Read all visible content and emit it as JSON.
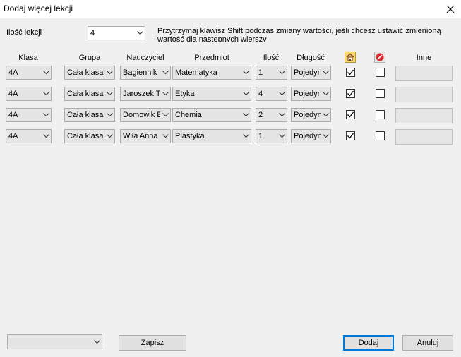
{
  "window": {
    "title": "Dodaj więcej lekcji"
  },
  "lesson_count": {
    "label": "Ilość lekcji",
    "value": "4"
  },
  "hint": "Przytrzymaj klawisz Shift podczas zmiany wartości, jeśli chcesz ustawić zmienioną wartość dla następnych wierszy",
  "columns": {
    "klasa": "Klasa",
    "grupa": "Grupa",
    "nauczyciel": "Nauczyciel",
    "przedmiot": "Przedmiot",
    "ilosc": "Ilość",
    "dlugosc": "Długość",
    "inne": "Inne"
  },
  "rows": [
    {
      "klasa": "4A",
      "grupa": "Cała klasa",
      "nauczyciel": "Bagiennik",
      "przedmiot": "Matematyka",
      "ilosc": "1",
      "dlugosc": "Pojedyn",
      "home_checked": true,
      "block_checked": false,
      "inne": ""
    },
    {
      "klasa": "4A",
      "grupa": "Cała klasa",
      "nauczyciel": "Jaroszek T",
      "przedmiot": "Etyka",
      "ilosc": "4",
      "dlugosc": "Pojedyn",
      "home_checked": true,
      "block_checked": false,
      "inne": ""
    },
    {
      "klasa": "4A",
      "grupa": "Cała klasa",
      "nauczyciel": "Domowik E",
      "przedmiot": "Chemia",
      "ilosc": "2",
      "dlugosc": "Pojedyn",
      "home_checked": true,
      "block_checked": false,
      "inne": ""
    },
    {
      "klasa": "4A",
      "grupa": "Cała klasa",
      "nauczyciel": "Wiła Anna",
      "przedmiot": "Plastyka",
      "ilosc": "1",
      "dlugosc": "Pojedyn",
      "home_checked": true,
      "block_checked": false,
      "inne": ""
    }
  ],
  "footer": {
    "preset_value": "",
    "save_label": "Zapisz",
    "add_label": "Dodaj",
    "cancel_label": "Anuluj"
  },
  "icons": {
    "close": "close-icon",
    "dropdown": "chevron-down-icon",
    "home": "home-icon",
    "block": "no-entry-icon",
    "check": "check-icon"
  },
  "colors": {
    "default_button_border": "#0078d7",
    "block_icon": "#d92b2b",
    "home_icon_bg": "#f5d76e"
  }
}
